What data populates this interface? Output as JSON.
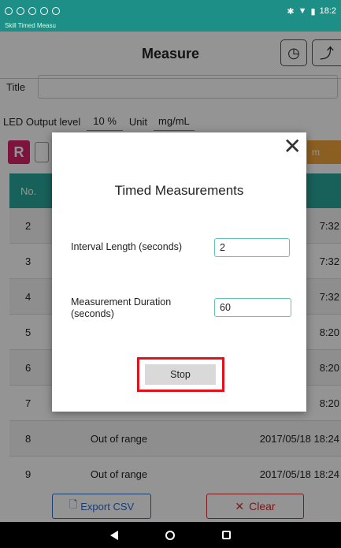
{
  "status_bar": {
    "time": "18:2",
    "sub_text": "Skill Timed Measu"
  },
  "header": {
    "title": "Measure",
    "clock_icon": "clock-icon",
    "chart_icon": "chart-icon"
  },
  "title_row": {
    "label": "Title",
    "value": ""
  },
  "led_row": {
    "label": "LED Output level",
    "value": "10 %",
    "unit_label": "Unit",
    "unit_value": "mg/mL"
  },
  "buttons": {
    "r_label": "R",
    "orange_label": "m"
  },
  "table": {
    "header_no": "No.",
    "rows": [
      {
        "no": "2",
        "value": "",
        "time": "7:32"
      },
      {
        "no": "3",
        "value": "",
        "time": "7:32"
      },
      {
        "no": "4",
        "value": "",
        "time": "7:32"
      },
      {
        "no": "5",
        "value": "",
        "time": "8:20"
      },
      {
        "no": "6",
        "value": "",
        "time": "8:20"
      },
      {
        "no": "7",
        "value": "",
        "time": "8:20"
      },
      {
        "no": "8",
        "value": "Out of range",
        "time": "2017/05/18 18:24"
      },
      {
        "no": "9",
        "value": "Out of range",
        "time": "2017/05/18 18:24"
      }
    ]
  },
  "bottom": {
    "export_label": "Export CSV",
    "clear_label": "Clear"
  },
  "dialog": {
    "title": "Timed Measurements",
    "close_symbol": "✕",
    "interval_label": "Interval Length (seconds)",
    "interval_value": "2",
    "duration_label_1": "Measurement Duration",
    "duration_label_2": "(seconds)",
    "duration_value": "60",
    "stop_label": "Stop"
  },
  "colors": {
    "accent": "#2aa59b",
    "highlight": "#e0121b",
    "danger": "#d42a2a",
    "link": "#2b6cc4"
  }
}
